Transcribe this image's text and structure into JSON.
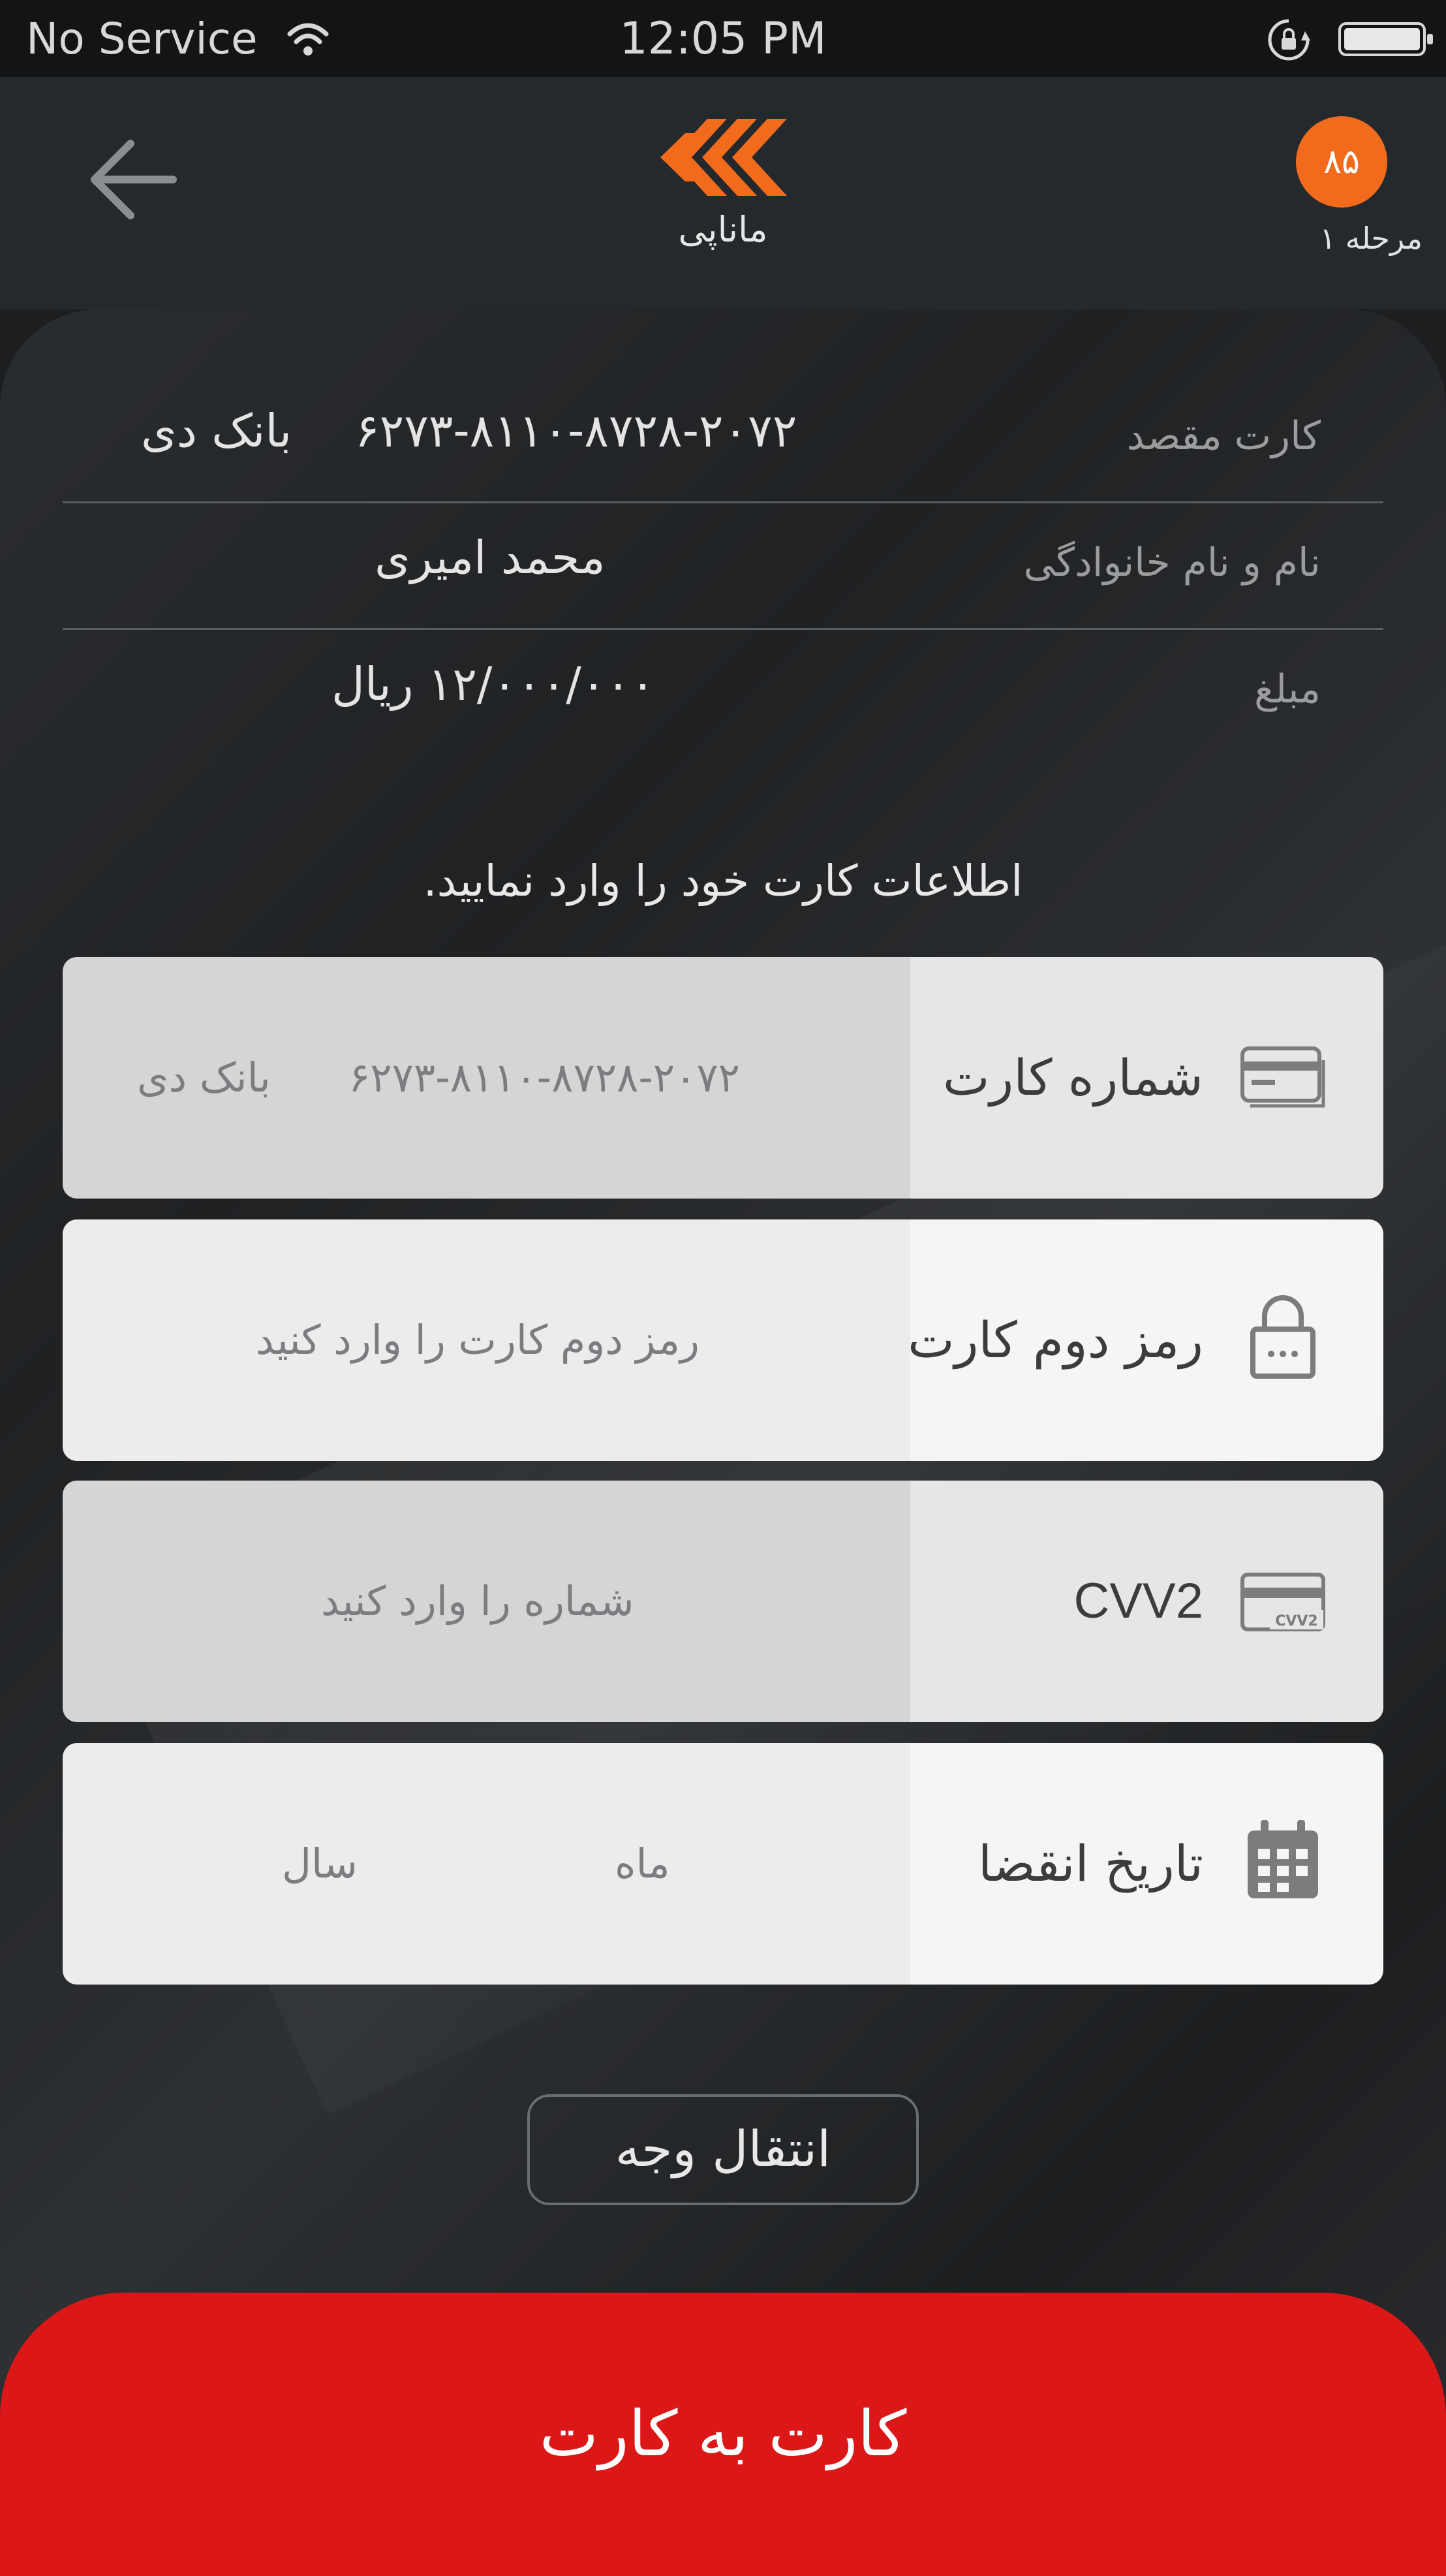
{
  "status_bar": {
    "carrier": "No Service",
    "time": "12:05 PM",
    "wifi_icon": "wifi-icon",
    "lock_icon": "rotation-lock-icon",
    "battery_icon": "battery-icon"
  },
  "header": {
    "back_icon": "arrow-left-icon",
    "brand_name": "ماناپی",
    "step_badge": "۸۵",
    "step_label": "مرحله ۱",
    "logo_color": "#f26b1d"
  },
  "transaction": {
    "rows": [
      {
        "label": "کارت مقصد",
        "value": "۶۲۷۳-۸۱۱۰-۸۷۲۸-۲۰۷۲",
        "bank": "بانک دی"
      },
      {
        "label": "نام و نام خانوادگی",
        "value": "محمد امیری"
      },
      {
        "label": "مبلغ",
        "value": "۱۲/۰۰۰/۰۰۰ ریال"
      }
    ]
  },
  "instruction": "اطلاعات کارت خود را وارد نمایید.",
  "form": {
    "card_number": {
      "label": "شماره کارت",
      "value": "۶۲۷۳-۸۱۱۰-۸۷۲۸-۲۰۷۲",
      "bank": "بانک دی",
      "icon": "credit-card-icon"
    },
    "pin2": {
      "label": "رمز دوم کارت",
      "placeholder": "رمز دوم کارت را وارد کنید",
      "icon": "lock-icon"
    },
    "cvv2": {
      "label": "CVV2",
      "placeholder": "شماره را وارد کنید",
      "icon": "cvv2-card-icon"
    },
    "expiry": {
      "label": "تاریخ انقضا",
      "month_placeholder": "ماه",
      "year_placeholder": "سال",
      "icon": "calendar-icon"
    }
  },
  "transfer_button": "انتقال وجه",
  "bottom_tab": "کارت به کارت",
  "colors": {
    "accent": "#f26b1d",
    "bottom_bar": "#dc1717",
    "header_bg": "#24292d"
  }
}
